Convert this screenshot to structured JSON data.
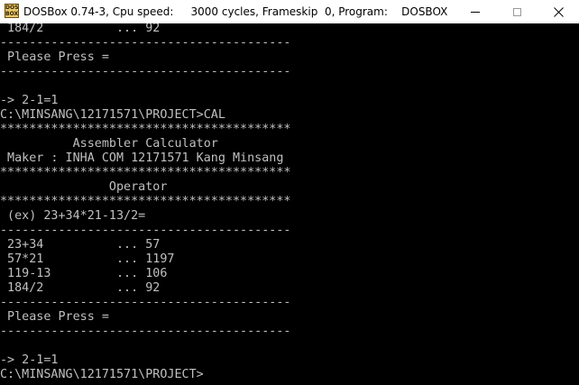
{
  "window": {
    "title": "DOSBox 0.74-3, Cpu speed:     3000 cycles, Frameskip  0, Program:    DOSBOX",
    "icon_text": "DOS BOX",
    "icon_name": "dosbox-app-icon",
    "controls": {
      "minimize_icon": "minimize-icon",
      "maximize_icon": "maximize-icon",
      "close_glyph": "✕"
    }
  },
  "console": {
    "lines": [
      " 184/2          ... 92",
      "----------------------------------------",
      " Please Press =",
      "----------------------------------------",
      "",
      "-> 2-1=1",
      "C:\\MINSANG\\12171571\\PROJECT>CAL",
      "****************************************",
      "          Assembler Calculator",
      " Maker : INHA COM 12171571 Kang Minsang",
      "****************************************",
      "               Operator",
      "****************************************",
      " (ex) 23+34*21-13/2=",
      "----------------------------------------",
      " 23+34          ... 57",
      " 57*21          ... 1197",
      " 119-13         ... 106",
      " 184/2          ... 92",
      "----------------------------------------",
      " Please Press =",
      "----------------------------------------",
      "",
      "-> 2-1=1",
      "C:\\MINSANG\\12171571\\PROJECT>"
    ]
  },
  "colors": {
    "console_bg": "#000000",
    "console_text": "#c0c0c0",
    "titlebar_bg": "#ffffff"
  }
}
